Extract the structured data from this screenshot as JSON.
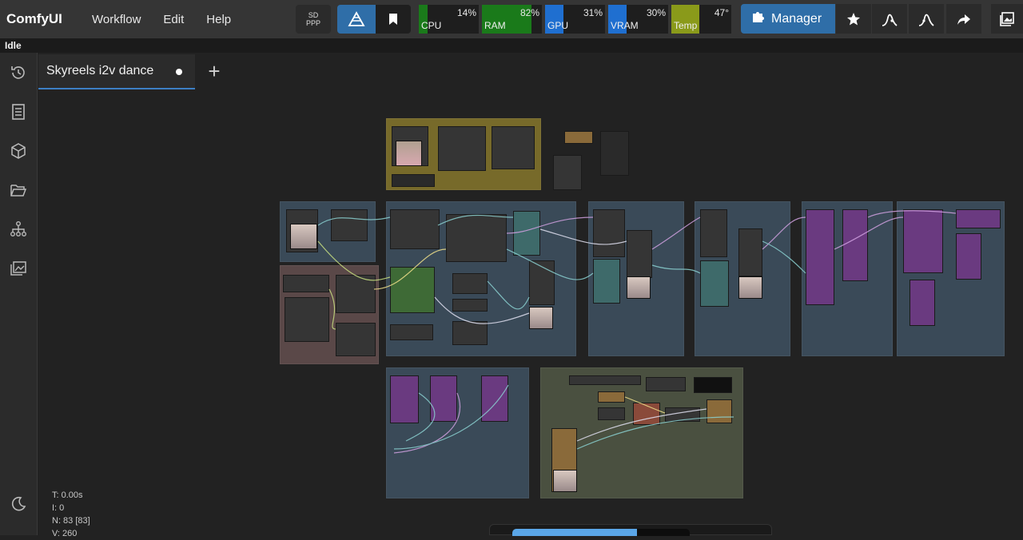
{
  "app": {
    "title": "ComfyUI"
  },
  "menu": {
    "items": [
      "Workflow",
      "Edit",
      "Help"
    ]
  },
  "toolbar": {
    "sd_ppp_line1": "SD",
    "sd_ppp_line2": "PPP"
  },
  "monitors": [
    {
      "label": "CPU",
      "value": "14%",
      "percent": 14,
      "color": "#1a7a1a"
    },
    {
      "label": "RAM",
      "value": "82%",
      "percent": 82,
      "color": "#1a7a1a"
    },
    {
      "label": "GPU",
      "value": "31%",
      "percent": 31,
      "color": "#1f6fd0"
    },
    {
      "label": "VRAM",
      "value": "30%",
      "percent": 30,
      "color": "#1f6fd0"
    },
    {
      "label": "Temp",
      "value": "47°",
      "percent": 47,
      "color": "#8a9a1a"
    }
  ],
  "manager": {
    "label": "Manager"
  },
  "status": {
    "text": "Idle"
  },
  "tabs": [
    {
      "label": "Skyreels i2v dance",
      "modified": true
    }
  ],
  "stats": {
    "t": "T: 0.00s",
    "i": "I: 0",
    "n": "N: 83 [83]",
    "v": "V: 260"
  },
  "colors": {
    "accent": "#2f6ea8",
    "canvas": "#222222",
    "topbar": "#353535"
  }
}
